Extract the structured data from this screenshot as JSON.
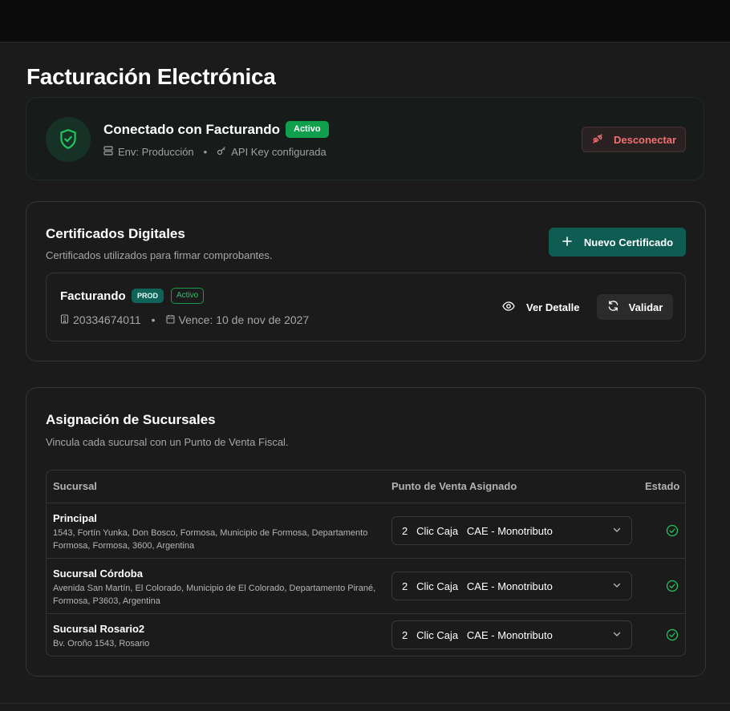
{
  "page": {
    "title": "Facturación Electrónica"
  },
  "connection": {
    "title": "Conectado con Facturando",
    "badge": "Activo",
    "env": "Env: Producción",
    "api_key": "API Key configurada",
    "disconnect_label": "Desconectar"
  },
  "certificates": {
    "title": "Certificados Digitales",
    "subtitle": "Certificados utilizados para firmar comprobantes.",
    "new_label": "Nuevo Certificado",
    "items": [
      {
        "name": "Facturando",
        "env_badge": "PROD",
        "status_badge": "Activo",
        "cuit": "20334674011",
        "expires": "Vence: 10 de nov de 2027",
        "view_label": "Ver Detalle",
        "validate_label": "Validar"
      }
    ]
  },
  "branches": {
    "title": "Asignación de Sucursales",
    "subtitle": "Vincula cada sucursal con un Punto de Venta Fiscal.",
    "columns": [
      "Sucursal",
      "Punto de Venta Asignado",
      "Estado"
    ],
    "rows": [
      {
        "name": "Principal",
        "address": "1543, Fortín Yunka, Don Bosco, Formosa, Municipio de Formosa, Departamento Formosa, Formosa, 3600, Argentina",
        "pos": "2   Clic Caja   CAE - Monotributo"
      },
      {
        "name": "Sucursal Córdoba",
        "address": "Avenida San Martín, El Colorado, Municipio de El Colorado, Departamento Pirané, Formosa, P3603, Argentina",
        "pos": "2   Clic Caja   CAE - Monotributo"
      },
      {
        "name": "Sucursal Rosario2",
        "address": "Bv. Oroño 1543, Rosario",
        "pos": "2   Clic Caja   CAE - Monotributo"
      }
    ]
  },
  "colors": {
    "accent": "#0e5c52",
    "success": "#0fa04d",
    "danger": "#f17070"
  }
}
